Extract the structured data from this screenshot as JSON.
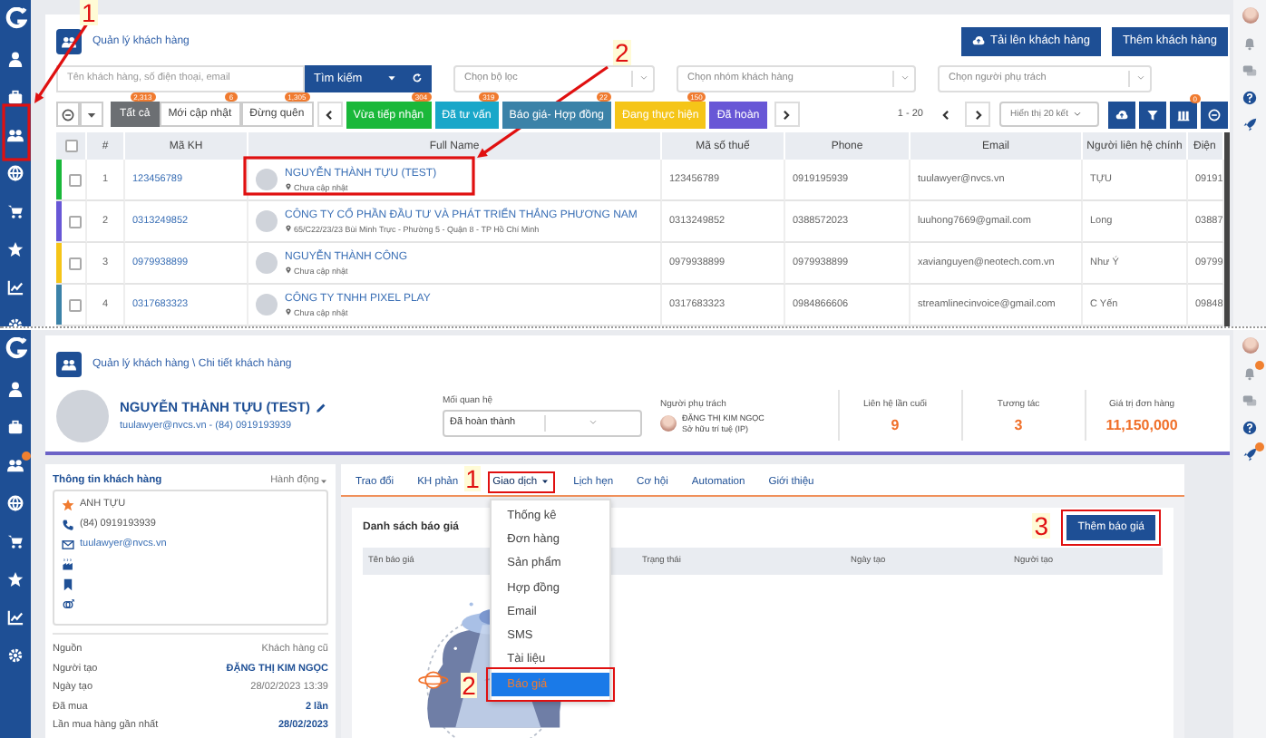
{
  "customer_list": {
    "breadcrumb": "Quản lý khách hàng",
    "actions": [
      {
        "label": "Tải lên khách hàng",
        "kind": "upload"
      },
      {
        "label": "Thêm khách hàng",
        "kind": "plain"
      }
    ],
    "search": {
      "placeholder": "Tên khách hàng, số điện thoại, email",
      "button": "Tìm kiếm"
    },
    "filters": [
      {
        "placeholder": "Chọn bộ lọc"
      },
      {
        "placeholder": "Chọn nhóm khách hàng"
      },
      {
        "placeholder": "Chọn người phụ trách"
      }
    ],
    "views": [
      {
        "label": "Tất cả",
        "count": "2,313",
        "selected": true
      },
      {
        "label": "Mới cập nhật",
        "count": "6",
        "selected": false
      },
      {
        "label": "Đừng quên",
        "count": "1,305",
        "selected": false
      }
    ],
    "stages": [
      {
        "label": "Vừa tiếp nhận",
        "count": "304",
        "color": "#1ab83a"
      },
      {
        "label": "Đã tư vấn",
        "count": "319",
        "color": "#19a7c9"
      },
      {
        "label": "Báo giá- Hợp đồng",
        "count": "22",
        "color": "#3b82a8"
      },
      {
        "label": "Đang thực hiện",
        "count": "150",
        "color": "#f5c518"
      },
      {
        "label": "Đã hoàn",
        "color": "#6857d6"
      }
    ],
    "pager": {
      "range": "1 - 20",
      "page_size": "Hiển thị 20 kết"
    },
    "toolbar_badge": "0",
    "table": {
      "select_all": {
        "checked": false
      },
      "columns": [
        "#",
        "Mã KH",
        "Full Name",
        "Mã số thuế",
        "Phone",
        "Email",
        "Người liên hệ chính",
        "Điện"
      ],
      "rows": [
        {
          "color": "#1ab83a",
          "checked": false,
          "number": "1",
          "code": "123456789",
          "name": "NGUYỄN THÀNH TỰU (TEST)",
          "address": "Chưa cập nhật",
          "tax_code": "123456789",
          "phone": "0919195939",
          "email": "tuulawyer@nvcs.vn",
          "contact": "TỰU",
          "column_9": "09191"
        },
        {
          "color": "#6857d6",
          "checked": false,
          "number": "2",
          "code": "0313249852",
          "name": "CÔNG TY CỔ PHẦN ĐẦU TƯ VÀ PHÁT TRIỂN THẮNG PHƯƠNG NAM",
          "address": "65/C22/23/23 Bùi Minh Trực - Phường 5 - Quận 8 - TP Hồ Chí Minh",
          "tax_code": "0313249852",
          "phone": "0388572023",
          "email": "luuhong7669@gmail.com",
          "contact": "Long",
          "column_9": "03887"
        },
        {
          "color": "#f5c518",
          "checked": false,
          "number": "3",
          "code": "0979938899",
          "name": "NGUYỄN THÀNH CÔNG",
          "address": "Chưa cập nhật",
          "tax_code": "0979938899",
          "phone": "0979938899",
          "email": "xavianguyen@neotech.com.vn",
          "contact": "Như Ý",
          "column_9": "09799"
        },
        {
          "color": "#3b82a8",
          "checked": false,
          "number": "4",
          "code": "0317683323",
          "name": "CÔNG TY TNHH PIXEL PLAY",
          "address": "Chưa cập nhật",
          "tax_code": "0317683323",
          "phone": "0984866606",
          "email": "streamlinecinvoice@gmail.com",
          "contact": "C Yến",
          "column_9": "09848"
        }
      ]
    },
    "annotations": [
      {
        "label": "1"
      },
      {
        "label": "2"
      }
    ]
  },
  "customer_detail": {
    "breadcrumb": "Quản lý khách hàng \\ Chi tiết khách hàng",
    "name": "NGUYỄN THÀNH TỰU (TEST)",
    "contact_line": "tuulawyer@nvcs.vn - (84) 0919193939",
    "relationship": {
      "label": "Mối quan hệ",
      "value": "Đã hoàn thành"
    },
    "owner": {
      "label": "Người phụ trách",
      "name": "ĐẶNG THỊ KIM NGỌC",
      "team": "Sở hữu trí tuệ (IP)"
    },
    "stats": [
      {
        "label": "Liên hệ lần cuối",
        "value": "9"
      },
      {
        "label": "Tương tác",
        "value": "3"
      },
      {
        "label": "Giá trị đơn hàng",
        "value": "11,150,000"
      }
    ],
    "info": {
      "title": "Thông tin khách hàng",
      "action": "Hành động",
      "items": [
        {
          "kind": "person",
          "text": "ANH TỰU"
        },
        {
          "kind": "phone",
          "text": "(84) 0919193939"
        },
        {
          "kind": "email",
          "text": "tuulawyer@nvcs.vn"
        },
        {
          "kind": "company"
        },
        {
          "kind": "bookmark"
        },
        {
          "kind": "gender"
        }
      ]
    },
    "facts": [
      {
        "label": "Nguồn",
        "value": "Khách hàng cũ",
        "emphasis": false
      },
      {
        "label": "Người tạo",
        "value": "ĐẶNG THỊ KIM NGỌC",
        "emphasis": true
      },
      {
        "label": "Ngày tạo",
        "value": "28/02/2023 13:39",
        "emphasis": false
      },
      {
        "label": "Đã mua",
        "value": "2 lần",
        "emphasis": true
      },
      {
        "label": "Lần mua hàng gần nhất",
        "value": "28/02/2023",
        "emphasis": true
      }
    ],
    "tabs": [
      {
        "label": "Trao đổi",
        "kind": "link"
      },
      {
        "label": "KH phản",
        "kind": "link"
      },
      {
        "label": "Giao dịch",
        "kind": "menu",
        "expanded": true
      },
      {
        "label": "Lịch hẹn",
        "kind": "link"
      },
      {
        "label": "Cơ hội",
        "kind": "link"
      },
      {
        "label": "Automation",
        "kind": "link"
      },
      {
        "label": "Giới thiệu",
        "kind": "link"
      }
    ],
    "menu": [
      {
        "label": "Thống kê",
        "selected": false
      },
      {
        "label": "Đơn hàng",
        "selected": false
      },
      {
        "label": "Sản phẩm",
        "selected": false
      },
      {
        "label": "Hợp đồng",
        "selected": false
      },
      {
        "label": "Email",
        "selected": false
      },
      {
        "label": "SMS",
        "selected": false
      },
      {
        "label": "Tài liệu",
        "selected": false
      },
      {
        "label": "Báo giá",
        "selected": true
      }
    ],
    "quotes": {
      "title": "Danh sách báo giá",
      "button": "Thêm báo giá",
      "columns": [
        "Tên báo giá",
        "Trạng thái",
        "Ngày tạo",
        "Người tạo"
      ]
    },
    "annotations": [
      {
        "label": "1"
      },
      {
        "label": "2"
      },
      {
        "label": "3"
      }
    ]
  }
}
